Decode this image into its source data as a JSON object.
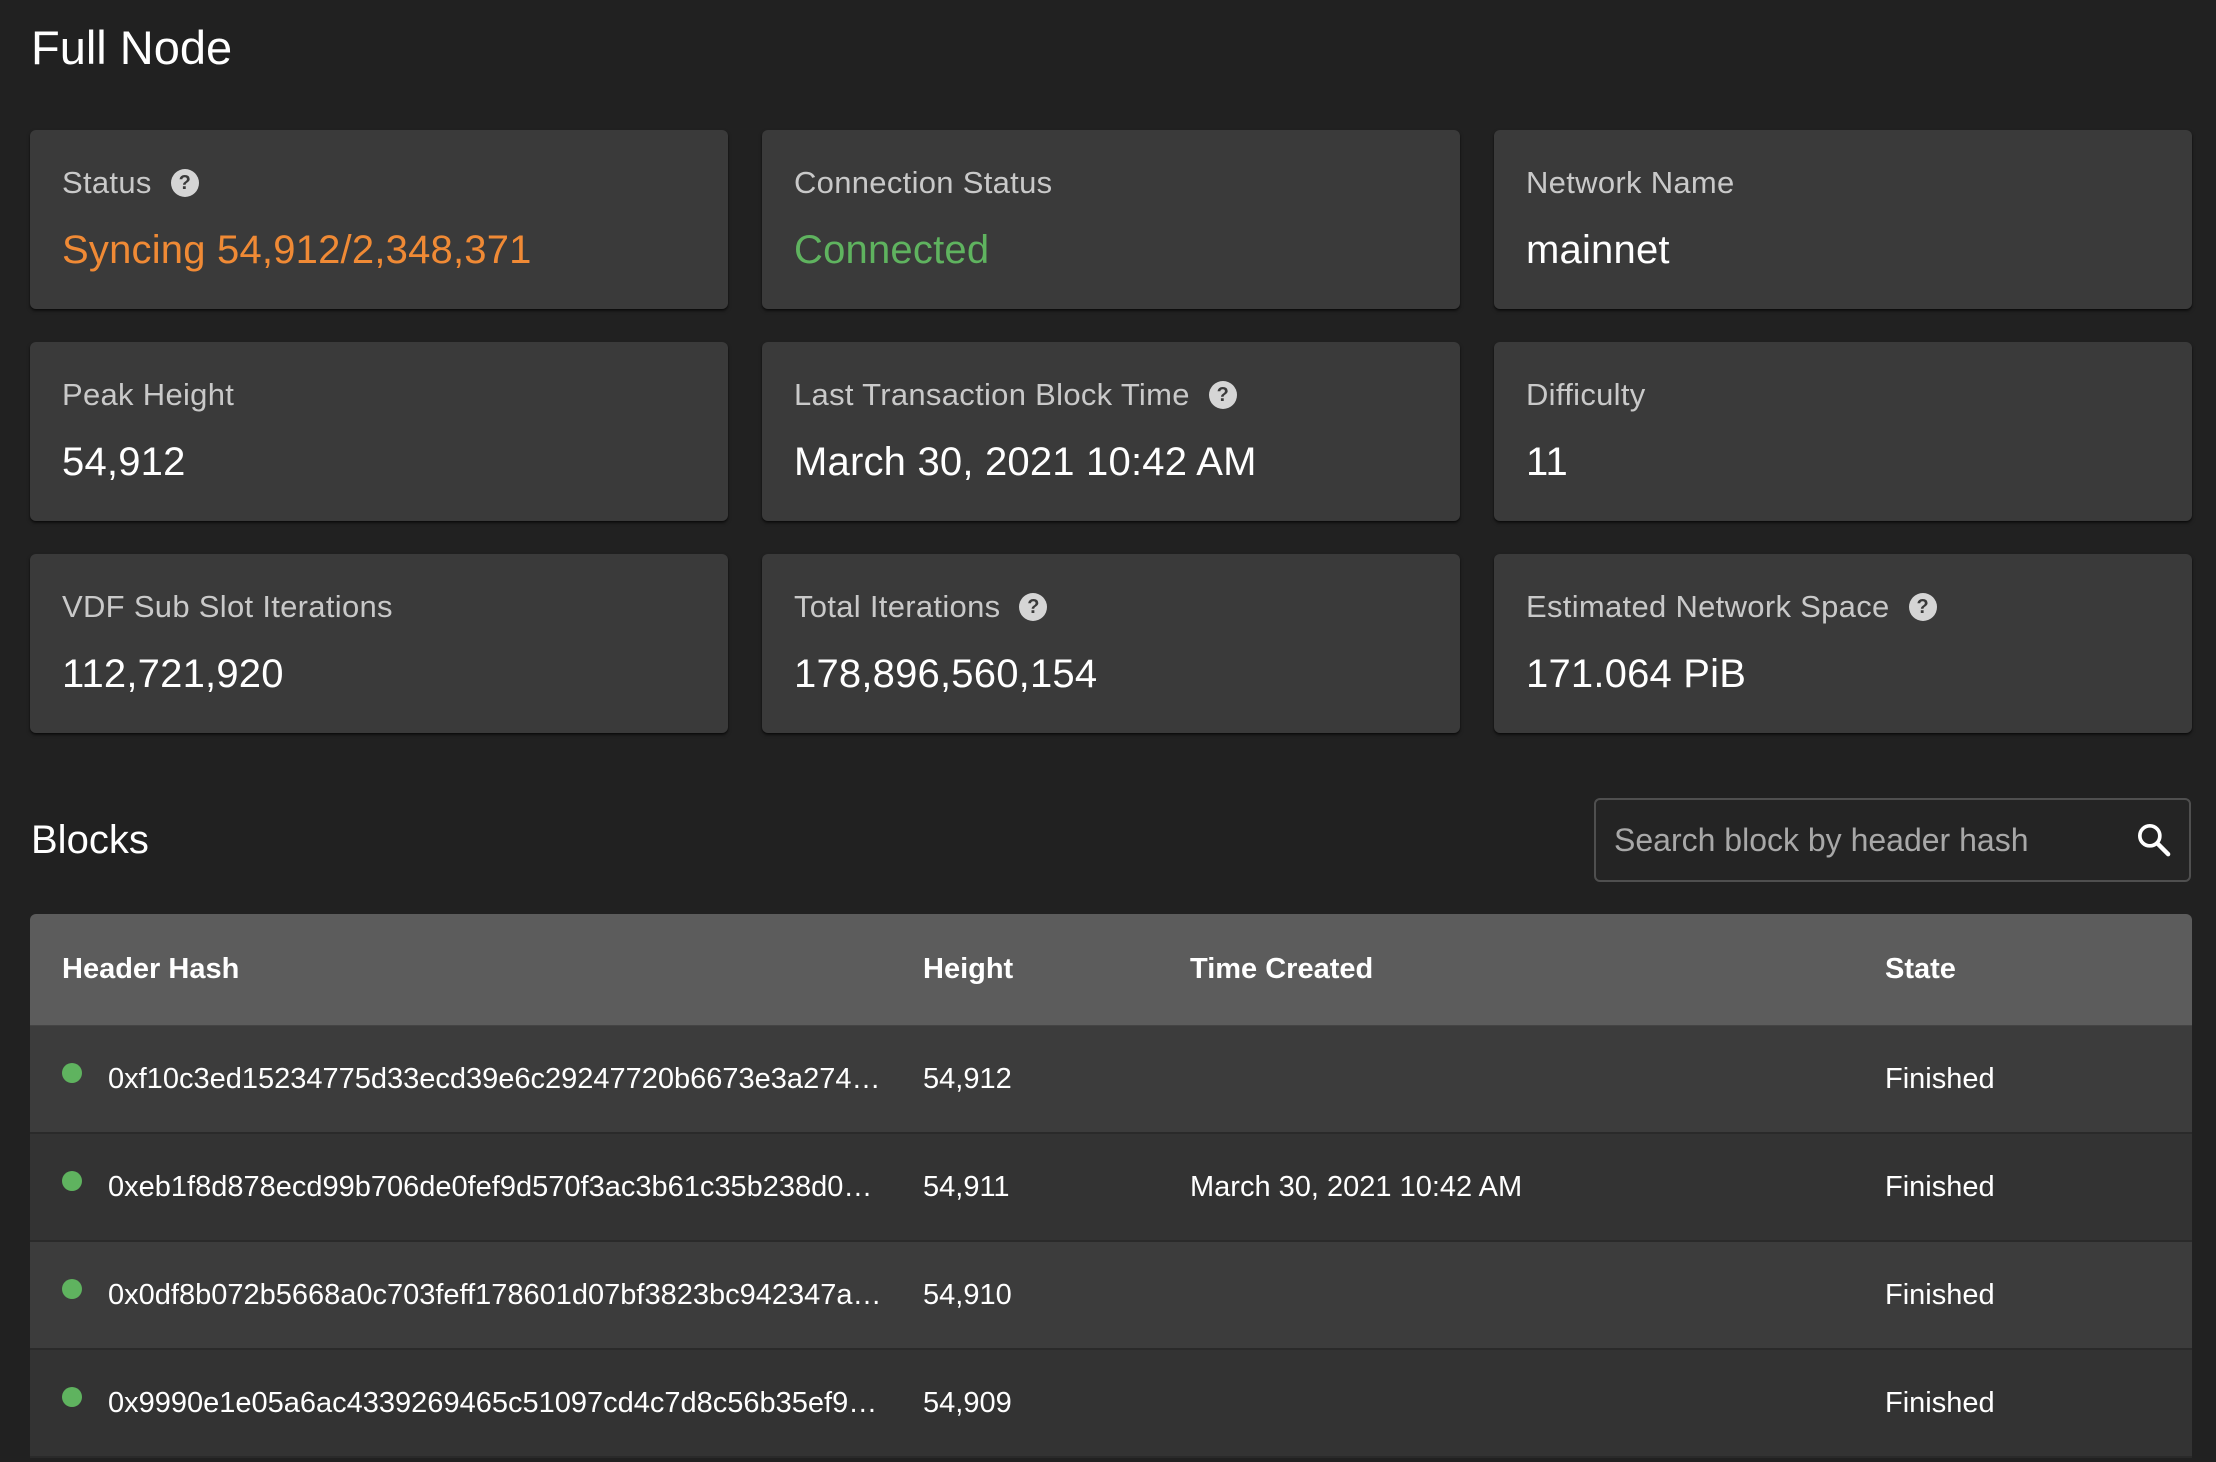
{
  "page": {
    "title": "Full Node"
  },
  "cards": [
    {
      "title": "Status",
      "help": true,
      "value": "Syncing 54,912/2,348,371",
      "color": "#f08a35"
    },
    {
      "title": "Connection Status",
      "help": false,
      "value": "Connected",
      "color": "#5fb35f"
    },
    {
      "title": "Network Name",
      "help": false,
      "value": "mainnet",
      "color": "#ffffff"
    },
    {
      "title": "Peak Height",
      "help": false,
      "value": "54,912",
      "color": "#ffffff"
    },
    {
      "title": "Last Transaction Block Time",
      "help": true,
      "value": "March 30, 2021 10:42 AM",
      "color": "#ffffff"
    },
    {
      "title": "Difficulty",
      "help": false,
      "value": "11",
      "color": "#ffffff"
    },
    {
      "title": "VDF Sub Slot Iterations",
      "help": false,
      "value": "112,721,920",
      "color": "#ffffff"
    },
    {
      "title": "Total Iterations",
      "help": true,
      "value": "178,896,560,154",
      "color": "#ffffff"
    },
    {
      "title": "Estimated Network Space",
      "help": true,
      "value": "171.064 PiB",
      "color": "#ffffff"
    }
  ],
  "help_icon_glyph": "?",
  "blocks": {
    "title": "Blocks",
    "search": {
      "placeholder": "Search block by header hash",
      "value": "",
      "icon": "search-icon"
    },
    "columns": [
      "Header Hash",
      "Height",
      "Time Created",
      "State"
    ],
    "rows": [
      {
        "hash": "0xf10c3ed15234775d33ecd39e6c29247720b6673e3a2744…",
        "height": "54,912",
        "time": "",
        "state": "Finished",
        "status_color": "#5fb35f"
      },
      {
        "hash": "0xeb1f8d878ecd99b706de0fef9d570f3ac3b61c35b238d05…",
        "height": "54,911",
        "time": "March 30, 2021 10:42 AM",
        "state": "Finished",
        "status_color": "#5fb35f"
      },
      {
        "hash": "0x0df8b072b5668a0c703feff178601d07bf3823bc942347a…",
        "height": "54,910",
        "time": "",
        "state": "Finished",
        "status_color": "#5fb35f"
      },
      {
        "hash": "0x9990e1e05a6ac4339269465c51097cd4c7d8c56b35ef9a…",
        "height": "54,909",
        "time": "",
        "state": "Finished",
        "status_color": "#5fb35f"
      }
    ]
  },
  "colors": {
    "background": "#212121",
    "card": "#3a3a3a",
    "syncing": "#f08a35",
    "connected": "#5fb35f",
    "table_header": "#5c5c5c"
  }
}
